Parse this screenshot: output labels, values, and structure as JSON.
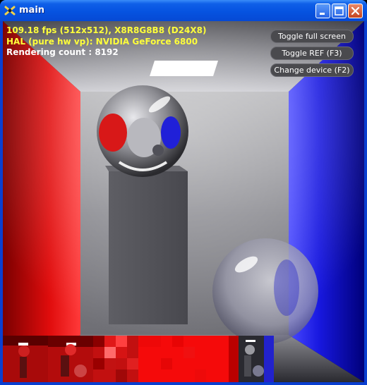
{
  "window": {
    "title": "main",
    "controls": {
      "minimize": "minimize-icon",
      "maximize": "maximize-icon",
      "close": "close-icon"
    }
  },
  "hud": {
    "line1": "109.18 fps (512x512), X8R8G8B8 (D24X8)",
    "line2": "HAL (pure hw vp): NVIDIA GeForce 6800",
    "line3": "Rendering count : 8192",
    "colors": {
      "primary": "#ffff3a",
      "secondary": "#ffffff"
    }
  },
  "buttons": {
    "fullscreen": "Toggle full screen",
    "ref": "Toggle REF (F3)",
    "device": "Change device (F2)"
  },
  "scene": {
    "wall_colors": {
      "left": "#e81010",
      "right": "#1a1ae8",
      "back": "#8a8a90"
    }
  }
}
